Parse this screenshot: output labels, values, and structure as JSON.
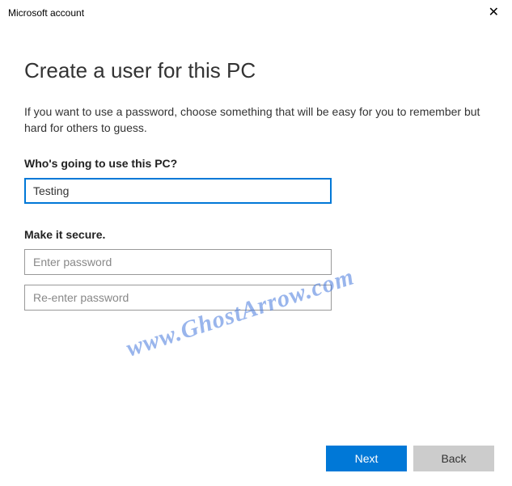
{
  "window": {
    "title": "Microsoft account"
  },
  "page": {
    "heading": "Create a user for this PC",
    "subtext": "If you want to use a password, choose something that will be easy for you to remember but hard for others to guess.",
    "who_label": "Who's going to use this PC?",
    "username_value": "Testing",
    "secure_label": "Make it secure.",
    "password_placeholder": "Enter password",
    "confirm_placeholder": "Re-enter password"
  },
  "buttons": {
    "next": "Next",
    "back": "Back"
  },
  "watermark": "www.GhostArrow.com"
}
